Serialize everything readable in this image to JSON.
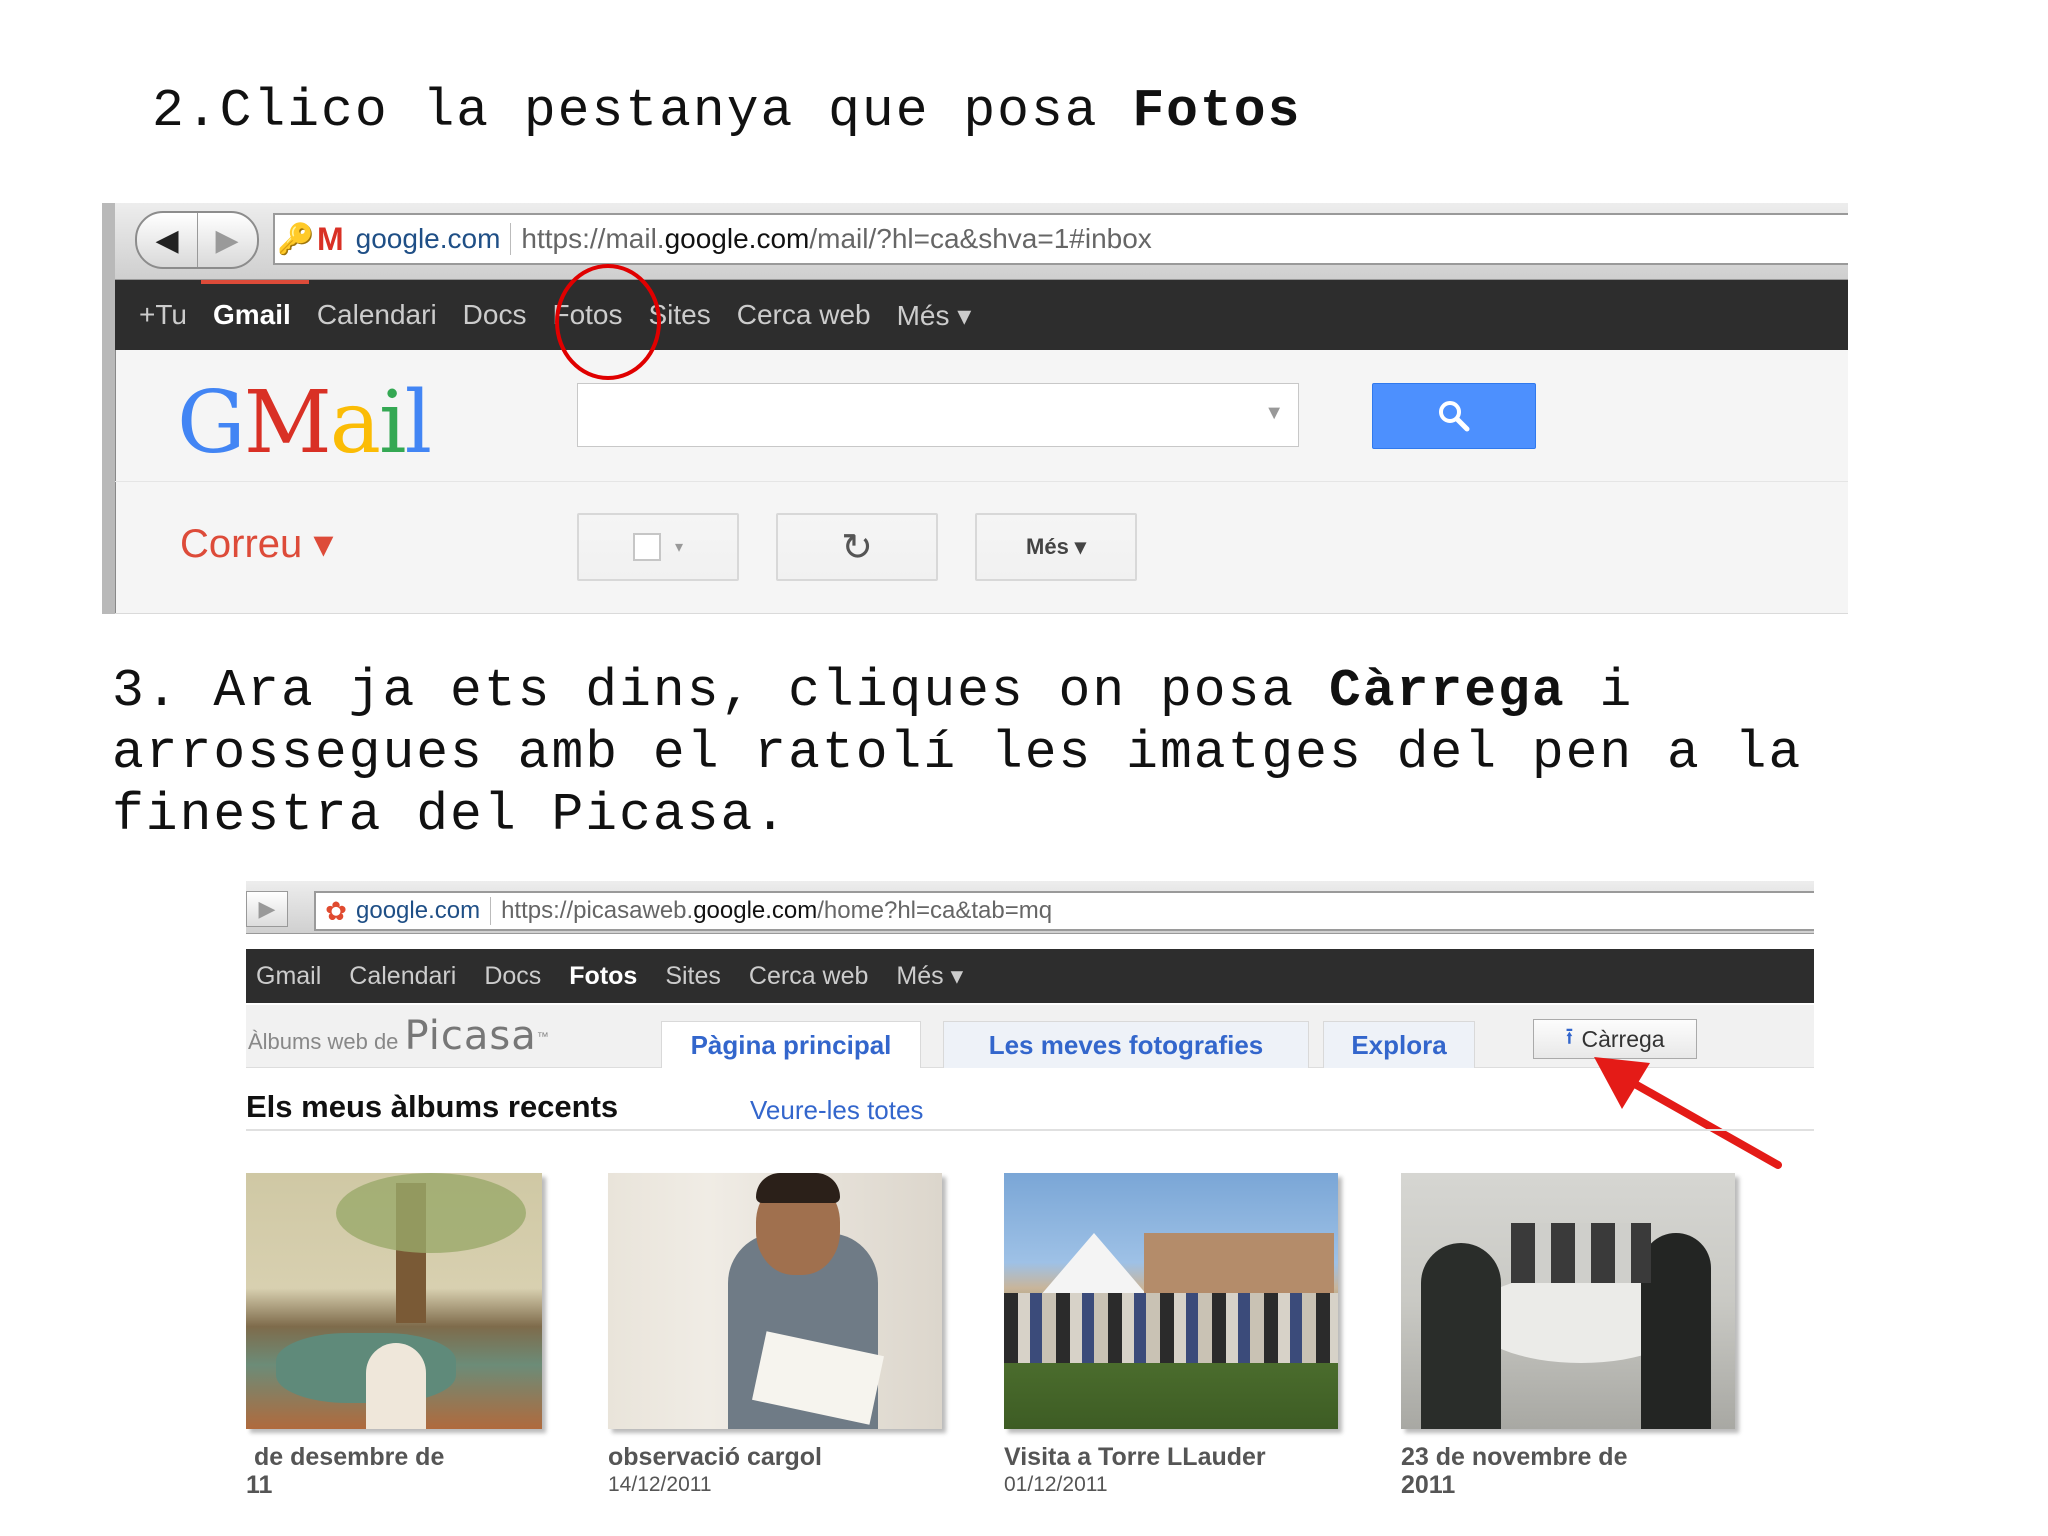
{
  "step2": {
    "number": "2.",
    "text": "Clico la pestanya que posa ",
    "bold": "Fotos"
  },
  "step3": {
    "line1_text": "3. Ara ja ets dins, cliques on posa ",
    "line1_bold": "Càrrega",
    "line1_end": " i",
    "line2": "arrossegues amb el ratolí les imatges del pen a la",
    "line3": "finestra del Picasa."
  },
  "gmail_screen": {
    "address": {
      "domain": "google.com",
      "url_prefix": "https://mail.",
      "url_host": "google.com",
      "url_path": "/mail/?hl=ca&shva=1#inbox"
    },
    "nav": [
      "+Tu",
      "Gmail",
      "Calendari",
      "Docs",
      "Fotos",
      "Sites",
      "Cerca web",
      "Més ▾"
    ],
    "logo_letters": [
      "G",
      "M",
      "a",
      "i",
      "l"
    ],
    "correu_label": "Correu ▾",
    "more_button": "Més ▾",
    "colors": {
      "blue": "#4285f4",
      "red": "#d93025",
      "yellow": "#fbbc05",
      "green": "#34a853",
      "accent": "#dd4b39"
    }
  },
  "picasa_screen": {
    "address": {
      "domain": "google.com",
      "url_prefix": "https://picasaweb.",
      "url_host": "google.com",
      "url_path": "/home?hl=ca&tab=mq"
    },
    "nav": [
      "Gmail",
      "Calendari",
      "Docs",
      "Fotos",
      "Sites",
      "Cerca web",
      "Més ▾"
    ],
    "brand_small": "Àlbums web de",
    "brand_big": "Picasa",
    "brand_tm": "™",
    "tabs": [
      "Pàgina principal",
      "Les meves fotografies",
      "Explora"
    ],
    "upload_button": "Càrrega",
    "recent_title": "Els meus àlbums recents",
    "see_all": "Veure-les totes",
    "albums": [
      {
        "title": "de desembre de",
        "date": "11"
      },
      {
        "title": "observació cargol",
        "date": "14/12/2011"
      },
      {
        "title": "Visita a Torre LLauder",
        "date": "01/12/2011"
      },
      {
        "title": "23 de novembre de",
        "date": "2011"
      }
    ]
  }
}
